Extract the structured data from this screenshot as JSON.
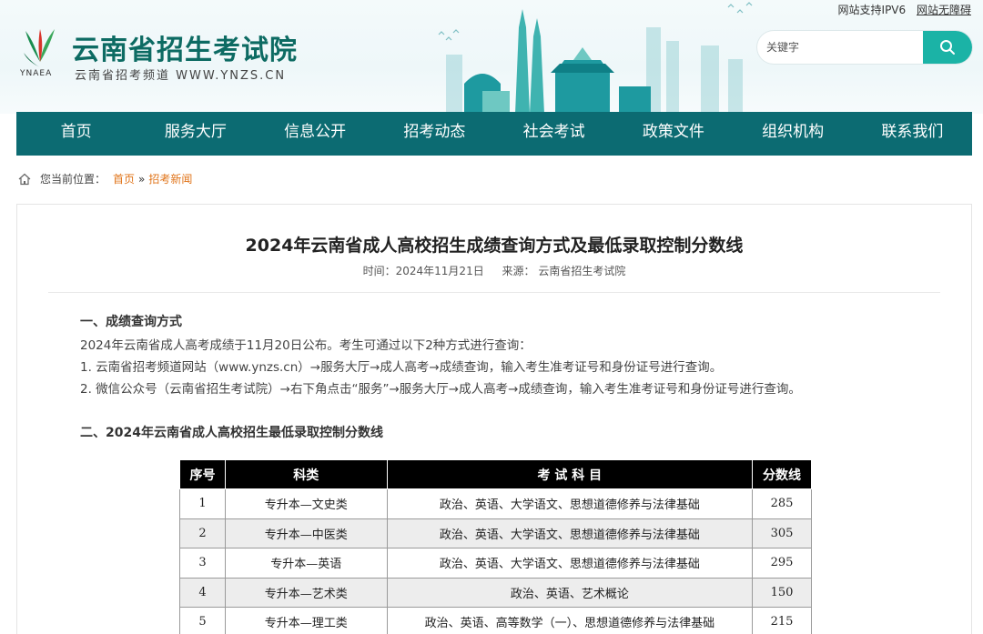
{
  "top_links": {
    "ipv6": "网站支持IPV6",
    "accessibility": "网站无障碍"
  },
  "logo": {
    "en_text": "YNAEA"
  },
  "site": {
    "title": "云南省招生考试院",
    "subtitle": "云南省招考频道 WWW.YNZS.CN"
  },
  "search": {
    "placeholder": "关键字",
    "value": "",
    "icon": "search-icon"
  },
  "nav": [
    "首页",
    "服务大厅",
    "信息公开",
    "招考动态",
    "社会考试",
    "政策文件",
    "组织机构",
    "联系我们"
  ],
  "breadcrumb": {
    "label": "您当前位置：",
    "home": "首页",
    "sep": "»",
    "current": "招考新闻"
  },
  "article": {
    "title": "2024年云南省成人高校招生成绩查询方式及最低录取控制分数线",
    "time_label": "时间：2024年11月21日",
    "source_label": "来源： 云南省招生考试院",
    "section1_title": "一、成绩查询方式",
    "p1": "2024年云南省成人高考成绩于11月20日公布。考生可通过以下2种方式进行查询：",
    "p2": "1. 云南省招考频道网站（www.ynzs.cn）→服务大厅→成人高考→成绩查询，输入考生准考证号和身份证号进行查询。",
    "p3": "2. 微信公众号（云南省招生考试院）→右下角点击“服务”→服务大厅→成人高考→成绩查询，输入考生准考证号和身份证号进行查询。",
    "section2_title": "二、2024年云南省成人高校招生最低录取控制分数线"
  },
  "table": {
    "headers": [
      "序号",
      "科类",
      "考 试 科 目",
      "分数线"
    ],
    "rows": [
      [
        "1",
        "专升本—文史类",
        "政治、英语、大学语文、思想道德修养与法律基础",
        "285"
      ],
      [
        "2",
        "专升本—中医类",
        "政治、英语、大学语文、思想道德修养与法律基础",
        "305"
      ],
      [
        "3",
        "专升本—英语",
        "政治、英语、大学语文、思想道德修养与法律基础",
        "295"
      ],
      [
        "4",
        "专升本—艺术类",
        "政治、英语、艺术概论",
        "150"
      ],
      [
        "5",
        "专升本—理工类",
        "政治、英语、高等数学（一）、思想道德修养与法律基础",
        "215"
      ]
    ]
  },
  "colors": {
    "nav_bg": "#0c6b72",
    "brand": "#0d6b63",
    "search_btn": "#1bb3a6",
    "breadcrumb_link": "#e0741a",
    "table_header_bg": "#000000"
  }
}
